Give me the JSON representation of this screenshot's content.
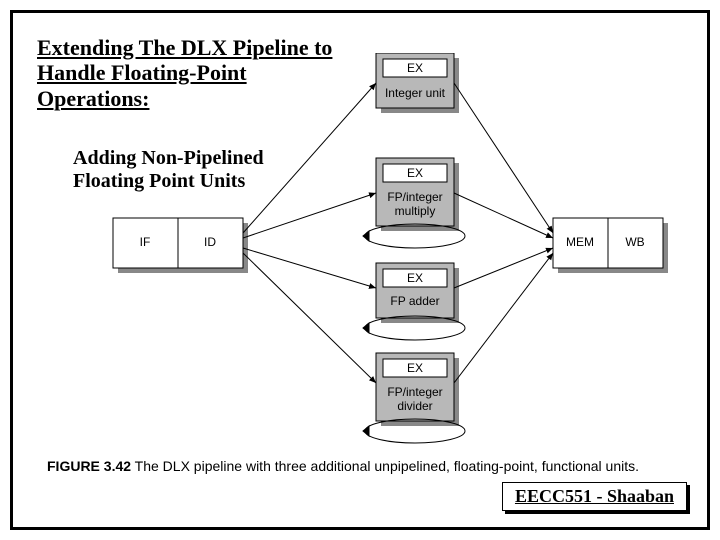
{
  "title": "Extending The DLX Pipeline to Handle Floating-Point Operations:",
  "subtitle": "Adding Non-Pipelined Floating Point Units",
  "caption_bold": "FIGURE 3.42",
  "caption_rest": " The DLX pipeline with three additional unpipelined, floating-point, functional units.",
  "footer": "EECC551 - Shaaban",
  "stages": {
    "if": "IF",
    "id": "ID",
    "mem": "MEM",
    "wb": "WB",
    "ex": "EX"
  },
  "units": {
    "integer": "Integer unit",
    "mul": "FP/integer multiply",
    "adder": "FP adder",
    "div": "FP/integer divider"
  }
}
